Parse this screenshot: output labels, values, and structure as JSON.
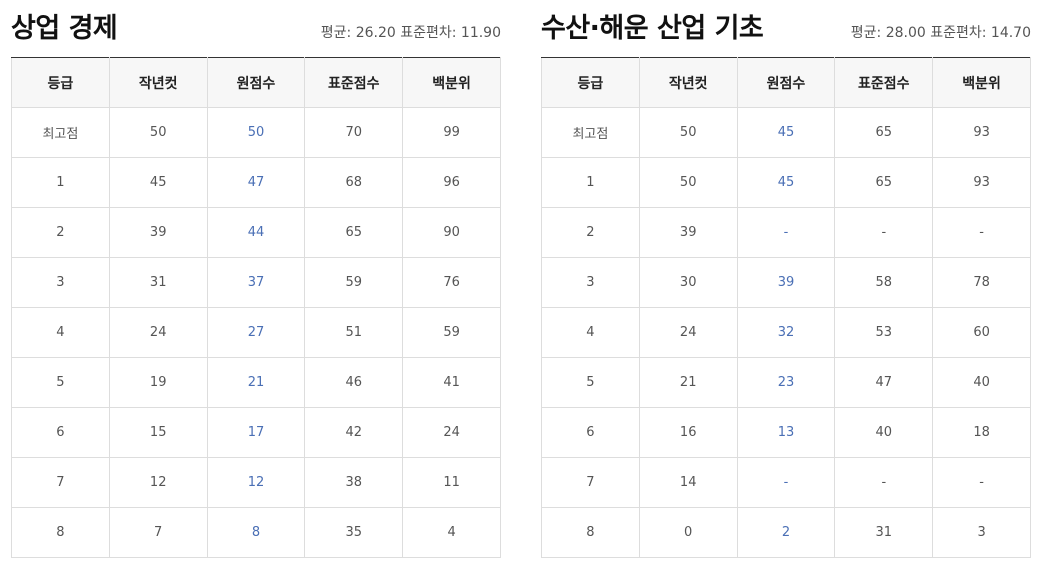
{
  "panels": [
    {
      "title": "상업 경제",
      "stats": "평균: 26.20 표준편차: 11.90",
      "columns": [
        "등급",
        "작년컷",
        "원점수",
        "표준점수",
        "백분위"
      ],
      "rows": [
        [
          "최고점",
          "50",
          "50",
          "70",
          "99"
        ],
        [
          "1",
          "45",
          "47",
          "68",
          "96"
        ],
        [
          "2",
          "39",
          "44",
          "65",
          "90"
        ],
        [
          "3",
          "31",
          "37",
          "59",
          "76"
        ],
        [
          "4",
          "24",
          "27",
          "51",
          "59"
        ],
        [
          "5",
          "19",
          "21",
          "46",
          "41"
        ],
        [
          "6",
          "15",
          "17",
          "42",
          "24"
        ],
        [
          "7",
          "12",
          "12",
          "38",
          "11"
        ],
        [
          "8",
          "7",
          "8",
          "35",
          "4"
        ]
      ]
    },
    {
      "title": "수산·해운 산업 기초",
      "stats": "평균: 28.00 표준편차: 14.70",
      "columns": [
        "등급",
        "작년컷",
        "원점수",
        "표준점수",
        "백분위"
      ],
      "rows": [
        [
          "최고점",
          "50",
          "45",
          "65",
          "93"
        ],
        [
          "1",
          "50",
          "45",
          "65",
          "93"
        ],
        [
          "2",
          "39",
          "-",
          "-",
          "-"
        ],
        [
          "3",
          "30",
          "39",
          "58",
          "78"
        ],
        [
          "4",
          "24",
          "32",
          "53",
          "60"
        ],
        [
          "5",
          "21",
          "23",
          "47",
          "40"
        ],
        [
          "6",
          "16",
          "13",
          "40",
          "18"
        ],
        [
          "7",
          "14",
          "-",
          "-",
          "-"
        ],
        [
          "8",
          "0",
          "2",
          "31",
          "3"
        ]
      ]
    }
  ],
  "colors": {
    "raw_score": "#4a6fb5",
    "header_bg": "#f7f7f7",
    "border": "#dddddd"
  }
}
